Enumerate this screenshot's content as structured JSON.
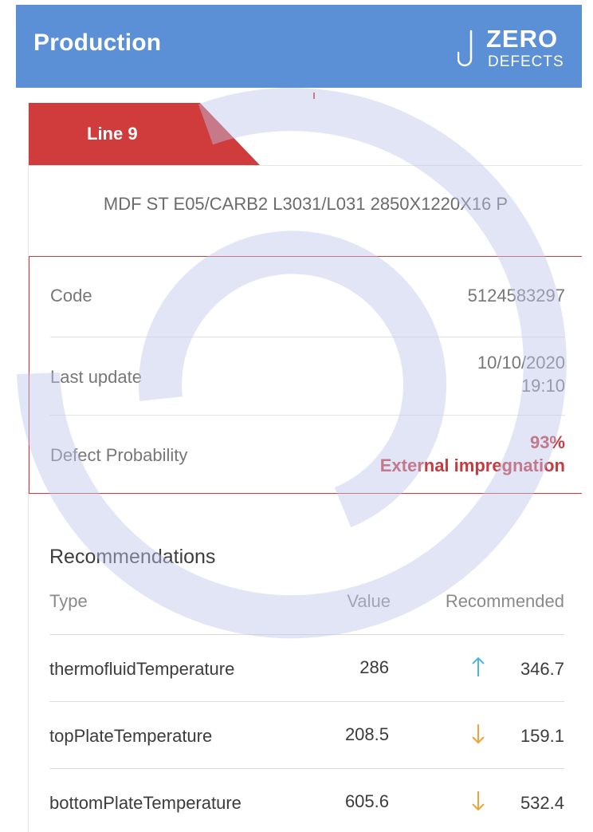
{
  "header": {
    "title": "Production",
    "logo_line1": "ZERO",
    "logo_line2": "DEFECTS"
  },
  "tab": {
    "label": "Line 9"
  },
  "product": {
    "name": "MDF ST E05/CARB2 L3031/L031 2850X1220X16 P"
  },
  "info": {
    "code_label": "Code",
    "code_value": "5124583297",
    "last_update_label": "Last update",
    "last_update_date": "10/10/2020",
    "last_update_time": "19:10",
    "defect_label": "Defect Probability",
    "defect_value": "93%",
    "defect_type": "External impregnation"
  },
  "recommendations": {
    "title": "Recommendations",
    "columns": {
      "type": "Type",
      "value": "Value",
      "recommended": "Recommended"
    },
    "rows": [
      {
        "type": "thermofluidTemperature",
        "value": "286",
        "arrow": "up-arrow-icon",
        "recommended": "346.7"
      },
      {
        "type": "topPlateTemperature",
        "value": "208.5",
        "arrow": "down-arrow-icon",
        "recommended": "159.1"
      },
      {
        "type": "bottomPlateTemperature",
        "value": "605.6",
        "arrow": "down-arrow-icon",
        "recommended": "532.4"
      }
    ]
  },
  "colors": {
    "header_bg": "#5b8fd6",
    "accent_red": "#d03b3b",
    "arrow_up": "#4fb3e8",
    "arrow_down": "#f0a23a"
  }
}
